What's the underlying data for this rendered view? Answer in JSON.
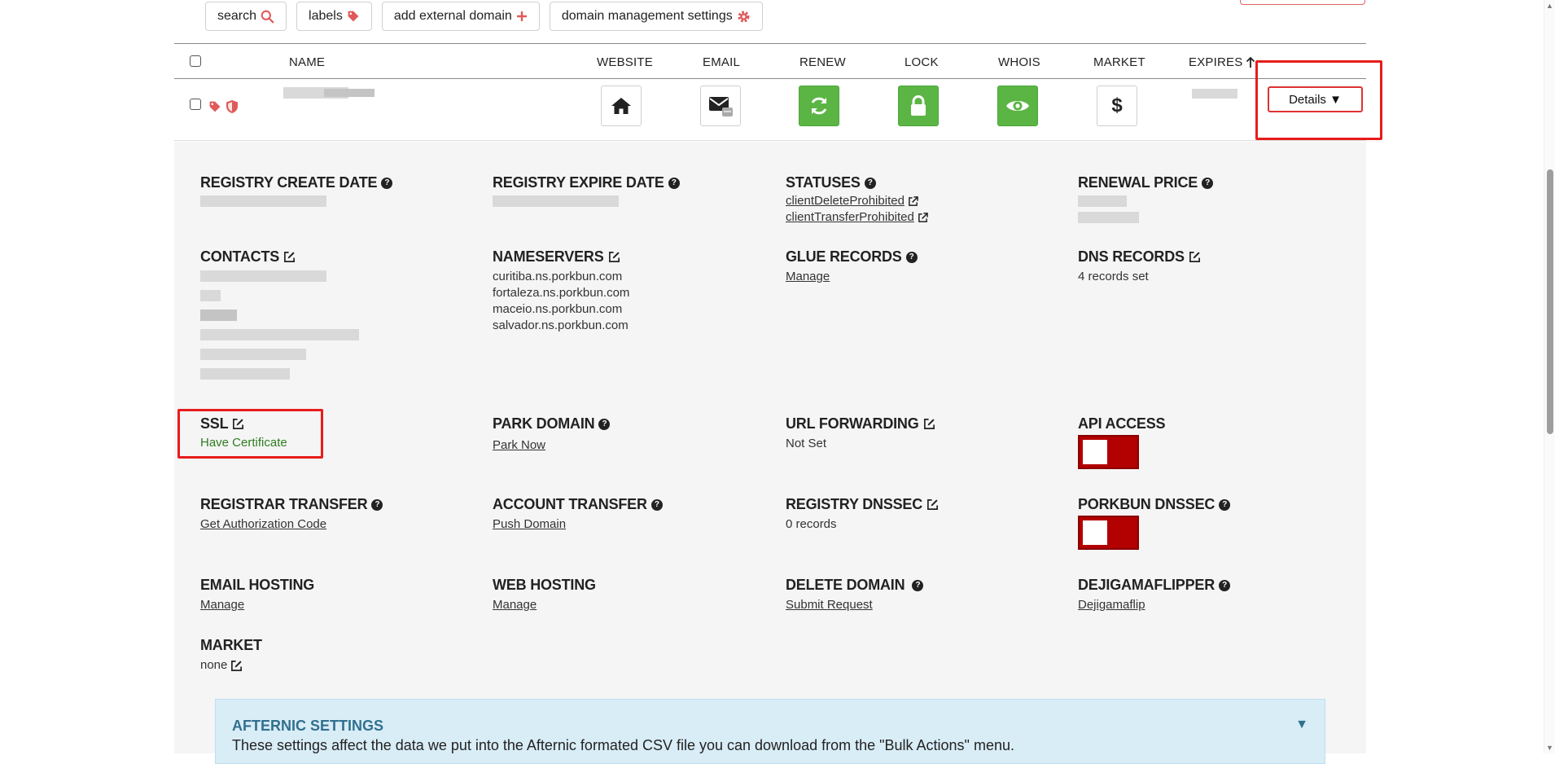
{
  "toolbar": {
    "search_label": "search",
    "labels_label": "labels",
    "add_domain_label": "add external domain",
    "settings_label": "domain management settings"
  },
  "columns": {
    "name": "NAME",
    "website": "WEBSITE",
    "email": "EMAIL",
    "renew": "RENEW",
    "lock": "LOCK",
    "whois": "WHOIS",
    "market": "MARKET",
    "expires": "EXPIRES"
  },
  "row": {
    "details_label": "Details ▼"
  },
  "details": {
    "registry_create_date": {
      "label": "REGISTRY CREATE DATE"
    },
    "registry_expire_date": {
      "label": "REGISTRY EXPIRE DATE"
    },
    "statuses": {
      "label": "STATUSES",
      "items": [
        "clientDeleteProhibited",
        "clientTransferProhibited"
      ]
    },
    "renewal_price": {
      "label": "RENEWAL PRICE"
    },
    "contacts": {
      "label": "CONTACTS"
    },
    "nameservers": {
      "label": "NAMESERVERS",
      "items": [
        "curitiba.ns.porkbun.com",
        "fortaleza.ns.porkbun.com",
        "maceio.ns.porkbun.com",
        "salvador.ns.porkbun.com"
      ]
    },
    "glue_records": {
      "label": "GLUE RECORDS",
      "link": "Manage"
    },
    "dns_records": {
      "label": "DNS RECORDS",
      "value": "4 records set"
    },
    "ssl": {
      "label": "SSL",
      "value": "Have Certificate"
    },
    "park_domain": {
      "label": "PARK DOMAIN",
      "link": "Park Now"
    },
    "url_forwarding": {
      "label": "URL FORWARDING",
      "value": "Not Set"
    },
    "api_access": {
      "label": "API ACCESS",
      "enabled": false
    },
    "registrar_transfer": {
      "label": "REGISTRAR TRANSFER",
      "link": "Get Authorization Code"
    },
    "account_transfer": {
      "label": "ACCOUNT TRANSFER",
      "link": "Push Domain"
    },
    "registry_dnssec": {
      "label": "REGISTRY DNSSEC",
      "value": "0 records"
    },
    "porkbun_dnssec": {
      "label": "PORKBUN DNSSEC",
      "enabled": false
    },
    "email_hosting": {
      "label": "EMAIL HOSTING",
      "link": "Manage"
    },
    "web_hosting": {
      "label": "WEB HOSTING",
      "link": "Manage"
    },
    "delete_domain": {
      "label": "DELETE DOMAIN",
      "link": "Submit Request"
    },
    "dejigamaflipper": {
      "label": "DEJIGAMAFLIPPER",
      "link": "Dejigamaflip"
    },
    "market": {
      "label": "MARKET",
      "value": "none"
    }
  },
  "afternic": {
    "title": "AFTERNIC SETTINGS",
    "description": "These settings affect the data we put into the Afternic formated CSV file you can download from the \"Bulk Actions\" menu."
  },
  "colors": {
    "accent_red": "#e05a5a",
    "green": "#5bb544",
    "toggle_red": "#b30000",
    "highlight": "#e81c1c",
    "info_blue": "#31708f"
  }
}
